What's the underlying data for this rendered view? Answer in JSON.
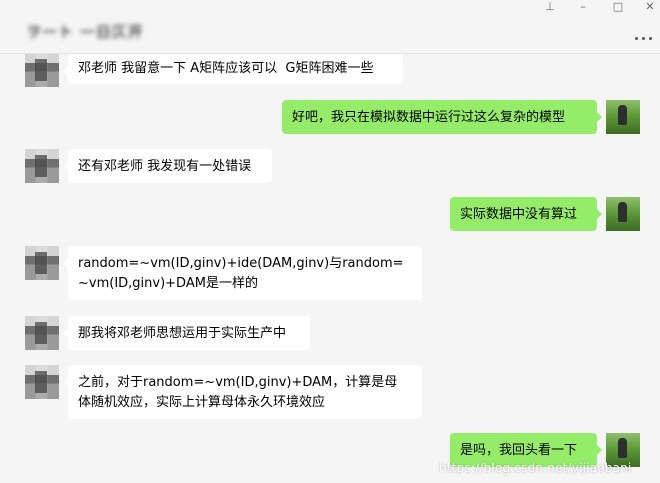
{
  "header": {
    "chat_title": "ヲ一ト 一日仄开",
    "more_icon": "more-dots-icon"
  },
  "window": {
    "pin_icon": "pin-icon",
    "pin_glyph": "⊥",
    "minimize_glyph": "–",
    "maximize_glyph": "□",
    "close_glyph": "✕"
  },
  "messages": [
    {
      "side": "in",
      "text": "邓老师 我留意一下 A矩阵应该可以  G矩阵困难一些"
    },
    {
      "side": "out",
      "text": "好吧，我只在模拟数据中运行过这么复杂的模型"
    },
    {
      "side": "in",
      "text": "还有邓老师 我发现有一处错误"
    },
    {
      "side": "out",
      "text": "实际数据中没有算过"
    },
    {
      "side": "in",
      "text": "random=~vm(ID,ginv)+ide(DAM,ginv)与random=\n~vm(ID,ginv)+DAM是一样的"
    },
    {
      "side": "in",
      "text": "那我将邓老师思想运用于实际生产中"
    },
    {
      "side": "in",
      "text": "之前，对于random=~vm(ID,ginv)+DAM，计算是母\n体随机效应，实际上计算母体永久环境效应"
    },
    {
      "side": "out",
      "text": "是吗，我回头看一下"
    }
  ],
  "watermark": "https://blog.csdn.net/yijiaobani",
  "colors": {
    "background": "#f5f5f5",
    "incoming_bubble": "#ffffff",
    "outgoing_bubble": "#95ec69"
  }
}
